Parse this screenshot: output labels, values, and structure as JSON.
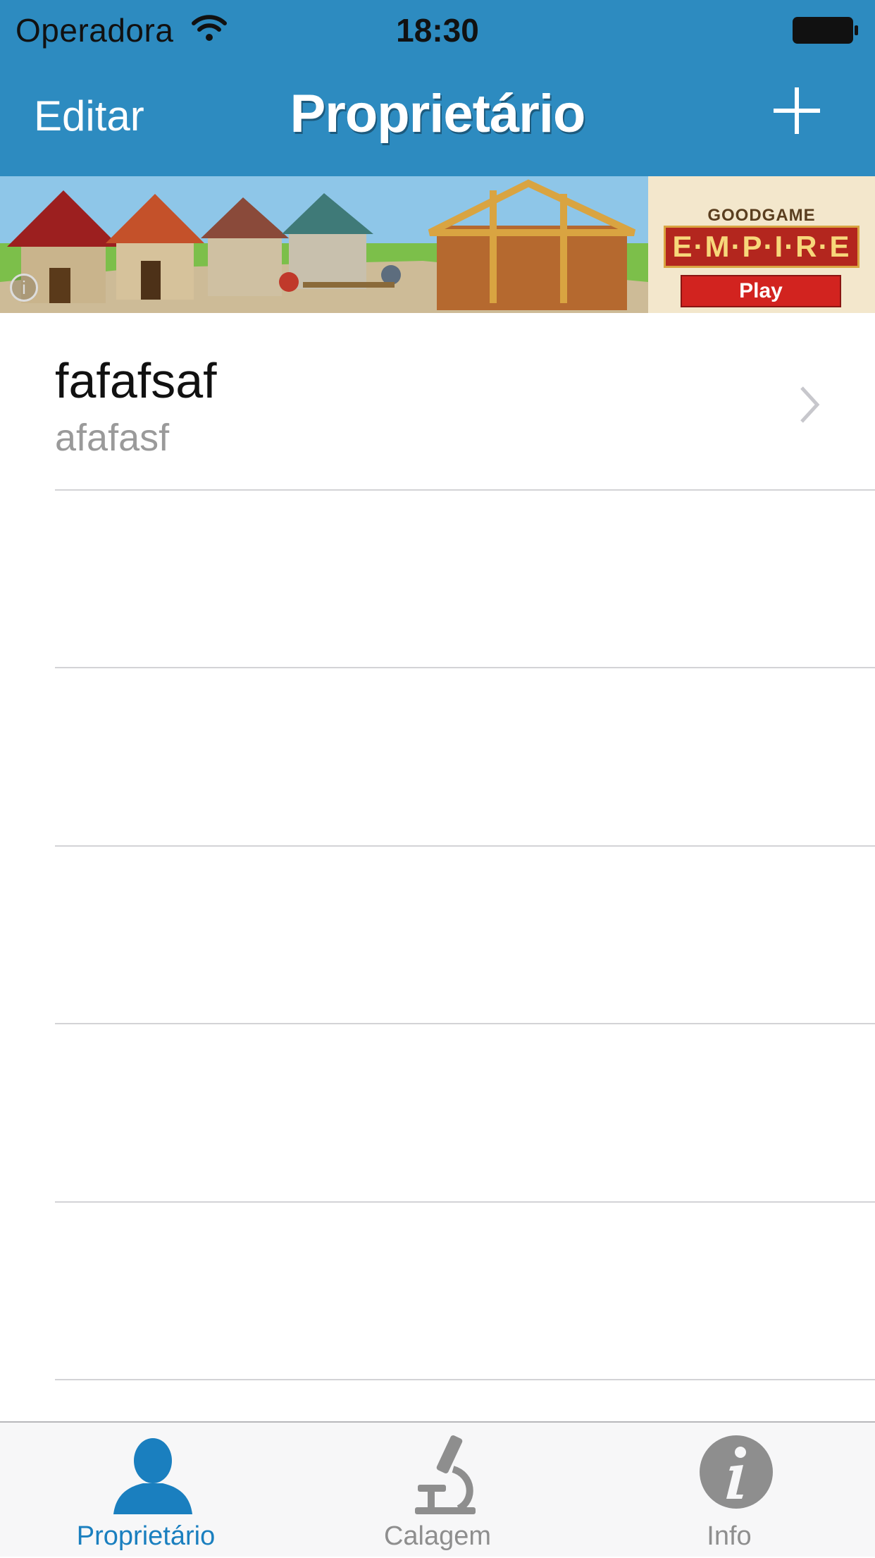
{
  "status_bar": {
    "carrier": "Operadora",
    "time": "18:30",
    "wifi_icon": "wifi-icon",
    "battery_icon": "battery-full-icon"
  },
  "nav": {
    "edit_label": "Editar",
    "title": "Proprietário",
    "add_icon": "plus-icon"
  },
  "ad": {
    "brand_top": "GOODGAME",
    "brand_main": "E·M·P·I·R·E",
    "cta": "Play",
    "info_glyph": "i"
  },
  "list": {
    "items": [
      {
        "title": "fafafsaf",
        "subtitle": "afafasf"
      }
    ]
  },
  "tabs": [
    {
      "label": "Proprietário",
      "icon": "person-icon",
      "active": true
    },
    {
      "label": "Calagem",
      "icon": "microscope-icon",
      "active": false
    },
    {
      "label": "Info",
      "icon": "info-icon",
      "active": false
    }
  ],
  "colors": {
    "nav_bg": "#2d8bc0",
    "tab_active": "#1a7fbf",
    "tab_inactive": "#8e8e8e"
  }
}
